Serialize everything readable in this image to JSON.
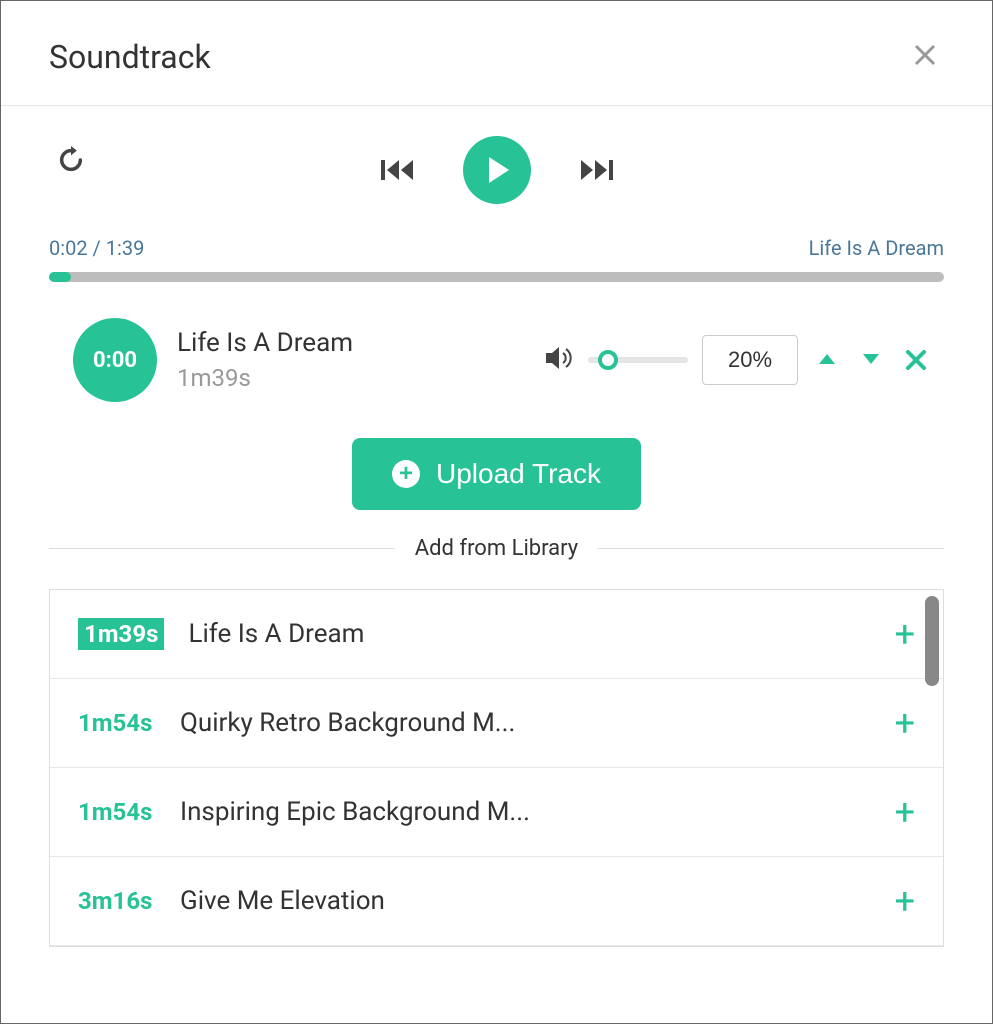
{
  "header": {
    "title": "Soundtrack"
  },
  "player": {
    "time_display": "0:02 / 1:39",
    "current_track_name": "Life Is A Dream"
  },
  "current_track": {
    "start_time": "0:00",
    "title": "Life Is A Dream",
    "duration": "1m39s",
    "volume": "20%"
  },
  "upload": {
    "button_label": "Upload Track"
  },
  "library": {
    "section_label": "Add from Library",
    "items": [
      {
        "duration": "1m39s",
        "title": "Life Is A Dream",
        "selected": true
      },
      {
        "duration": "1m54s",
        "title": "Quirky Retro Background M...",
        "selected": false
      },
      {
        "duration": "1m54s",
        "title": "Inspiring Epic Background M...",
        "selected": false
      },
      {
        "duration": "3m16s",
        "title": "Give Me Elevation",
        "selected": false
      }
    ]
  },
  "colors": {
    "accent": "#28c297"
  }
}
